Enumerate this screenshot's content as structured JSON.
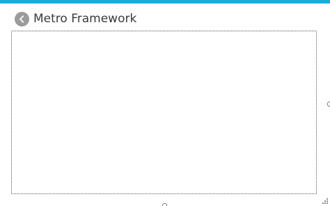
{
  "window": {
    "title": "Metro Framework",
    "accent_color": "#1aa9dc",
    "back_button_color": "#9b9b9b",
    "back_icon": "chevron-left-icon",
    "resize_grip_icon": "resize-grip-icon"
  }
}
